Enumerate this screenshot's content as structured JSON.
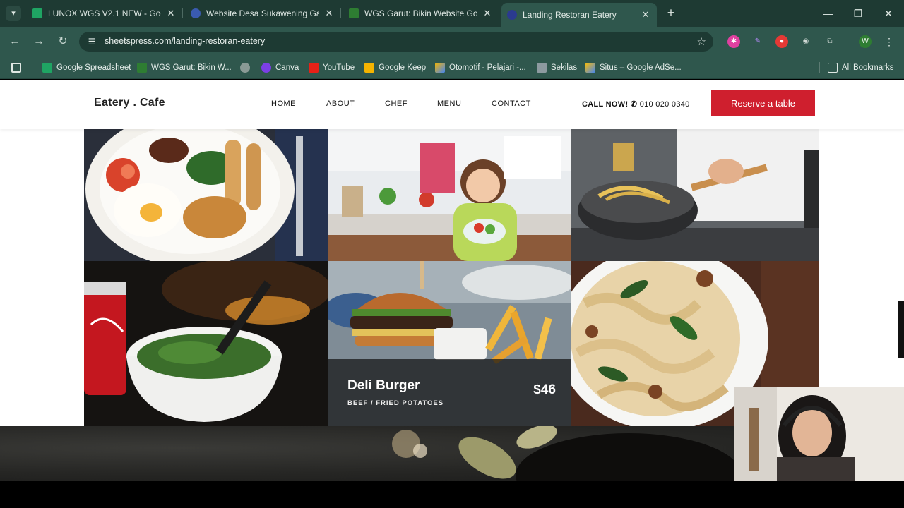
{
  "browser": {
    "tabs": [
      {
        "title": "LUNOX WGS V2.1 NEW - Googl",
        "active": false
      },
      {
        "title": "Website Desa Sukawening Garu",
        "active": false
      },
      {
        "title": "WGS Garut: Bikin Website Goog",
        "active": false
      },
      {
        "title": "Landing Restoran Eatery",
        "active": true
      }
    ],
    "url": "sheetspress.com/landing-restoran-eatery",
    "bookmarks": [
      {
        "label": "Google Spreadsheet"
      },
      {
        "label": "WGS Garut: Bikin W..."
      },
      {
        "label": ""
      },
      {
        "label": "Canva"
      },
      {
        "label": "YouTube"
      },
      {
        "label": "Google Keep"
      },
      {
        "label": "Otomotif - Pelajari -..."
      },
      {
        "label": "Sekilas"
      },
      {
        "label": "Situs – Google AdSe..."
      }
    ],
    "all_bookmarks": "All Bookmarks",
    "profile_initial": "W"
  },
  "site": {
    "logo": "Eatery . Cafe",
    "nav": [
      "HOME",
      "ABOUT",
      "CHEF",
      "MENU",
      "CONTACT"
    ],
    "call_label": "CALL NOW!",
    "call_number": "010 020 0340",
    "reserve": "Reserve a table"
  },
  "featured": {
    "name": "Deli Burger",
    "description": "BEEF / FRIED POTATOES",
    "price": "$46"
  },
  "colors": {
    "chrome_dark": "#1e3a33",
    "chrome": "#2f574d",
    "accent_red": "#cf1f2e"
  }
}
